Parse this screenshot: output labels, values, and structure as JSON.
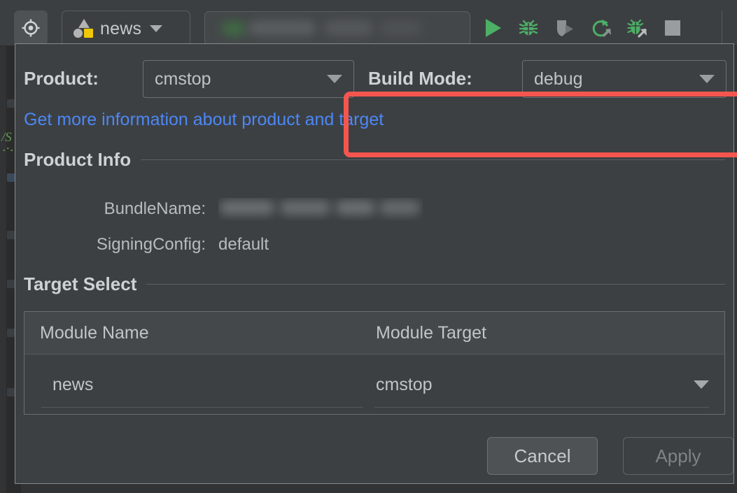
{
  "toolbar": {
    "target_icon": "crosshair-target-icon",
    "module_selector": {
      "label": "news",
      "icon": "module-shapes-icon",
      "caret": "chevron-down-icon"
    },
    "run_configuration": {
      "value": "",
      "redacted": true
    },
    "actions": [
      {
        "name": "run-button",
        "icon": "play-triangle-icon",
        "color": "#4caf66"
      },
      {
        "name": "debug-button",
        "icon": "bug-icon",
        "color": "#4caf66"
      },
      {
        "name": "profile-button",
        "icon": "shield-play-icon",
        "color": "#a4a7a9"
      },
      {
        "name": "rerun-button",
        "icon": "refresh-arrow-icon",
        "color": "#4caf66"
      },
      {
        "name": "attach-debugger-button",
        "icon": "bug-arrow-icon",
        "color": "#4caf66"
      },
      {
        "name": "stop-button",
        "icon": "stop-square-icon",
        "color": "#9a9d9f"
      }
    ]
  },
  "editor": {
    "code_fragment": "/S"
  },
  "dialog": {
    "product": {
      "label": "Product:",
      "value": "cmstop",
      "caret": "chevron-down-icon"
    },
    "build_mode": {
      "label": "Build Mode:",
      "value": "debug",
      "caret": "chevron-down-icon",
      "highlight_color": "#f4564f",
      "highlighted": true
    },
    "link": "Get more information about product and target",
    "product_info": {
      "title": "Product Info",
      "fields": [
        {
          "key": "BundleName:",
          "value": "",
          "redacted": true
        },
        {
          "key": "SigningConfig:",
          "value": "default",
          "redacted": false
        }
      ]
    },
    "target_select": {
      "title": "Target Select",
      "columns": [
        "Module Name",
        "Module Target"
      ],
      "rows": [
        {
          "module_name": "news",
          "module_target": "cmstop"
        }
      ]
    },
    "buttons": {
      "cancel": "Cancel",
      "apply": "Apply"
    }
  },
  "colors": {
    "accent_link": "#4d87f5",
    "annotation": "#f4564f",
    "dialog_bg": "#3c4043",
    "toolbar_bg": "#3c3f41",
    "green_action": "#4caf66",
    "module_icon_accent": "#f0c808"
  }
}
